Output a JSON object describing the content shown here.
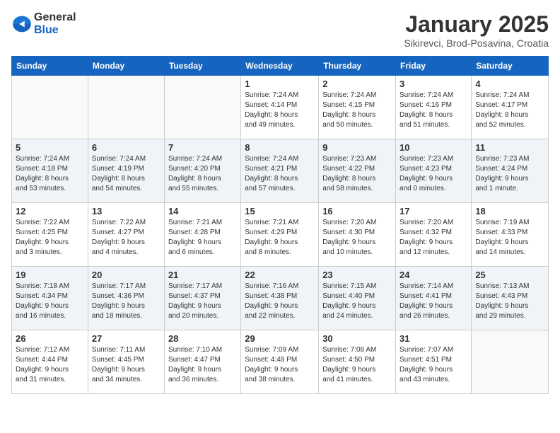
{
  "header": {
    "logo": {
      "general": "General",
      "blue": "Blue"
    },
    "title": "January 2025",
    "subtitle": "Sikirevci, Brod-Posavina, Croatia"
  },
  "days_of_week": [
    "Sunday",
    "Monday",
    "Tuesday",
    "Wednesday",
    "Thursday",
    "Friday",
    "Saturday"
  ],
  "weeks": [
    {
      "shade": false,
      "days": [
        {
          "num": "",
          "info": ""
        },
        {
          "num": "",
          "info": ""
        },
        {
          "num": "",
          "info": ""
        },
        {
          "num": "1",
          "info": "Sunrise: 7:24 AM\nSunset: 4:14 PM\nDaylight: 8 hours\nand 49 minutes."
        },
        {
          "num": "2",
          "info": "Sunrise: 7:24 AM\nSunset: 4:15 PM\nDaylight: 8 hours\nand 50 minutes."
        },
        {
          "num": "3",
          "info": "Sunrise: 7:24 AM\nSunset: 4:16 PM\nDaylight: 8 hours\nand 51 minutes."
        },
        {
          "num": "4",
          "info": "Sunrise: 7:24 AM\nSunset: 4:17 PM\nDaylight: 8 hours\nand 52 minutes."
        }
      ]
    },
    {
      "shade": true,
      "days": [
        {
          "num": "5",
          "info": "Sunrise: 7:24 AM\nSunset: 4:18 PM\nDaylight: 8 hours\nand 53 minutes."
        },
        {
          "num": "6",
          "info": "Sunrise: 7:24 AM\nSunset: 4:19 PM\nDaylight: 8 hours\nand 54 minutes."
        },
        {
          "num": "7",
          "info": "Sunrise: 7:24 AM\nSunset: 4:20 PM\nDaylight: 8 hours\nand 55 minutes."
        },
        {
          "num": "8",
          "info": "Sunrise: 7:24 AM\nSunset: 4:21 PM\nDaylight: 8 hours\nand 57 minutes."
        },
        {
          "num": "9",
          "info": "Sunrise: 7:23 AM\nSunset: 4:22 PM\nDaylight: 8 hours\nand 58 minutes."
        },
        {
          "num": "10",
          "info": "Sunrise: 7:23 AM\nSunset: 4:23 PM\nDaylight: 9 hours\nand 0 minutes."
        },
        {
          "num": "11",
          "info": "Sunrise: 7:23 AM\nSunset: 4:24 PM\nDaylight: 9 hours\nand 1 minute."
        }
      ]
    },
    {
      "shade": false,
      "days": [
        {
          "num": "12",
          "info": "Sunrise: 7:22 AM\nSunset: 4:25 PM\nDaylight: 9 hours\nand 3 minutes."
        },
        {
          "num": "13",
          "info": "Sunrise: 7:22 AM\nSunset: 4:27 PM\nDaylight: 9 hours\nand 4 minutes."
        },
        {
          "num": "14",
          "info": "Sunrise: 7:21 AM\nSunset: 4:28 PM\nDaylight: 9 hours\nand 6 minutes."
        },
        {
          "num": "15",
          "info": "Sunrise: 7:21 AM\nSunset: 4:29 PM\nDaylight: 9 hours\nand 8 minutes."
        },
        {
          "num": "16",
          "info": "Sunrise: 7:20 AM\nSunset: 4:30 PM\nDaylight: 9 hours\nand 10 minutes."
        },
        {
          "num": "17",
          "info": "Sunrise: 7:20 AM\nSunset: 4:32 PM\nDaylight: 9 hours\nand 12 minutes."
        },
        {
          "num": "18",
          "info": "Sunrise: 7:19 AM\nSunset: 4:33 PM\nDaylight: 9 hours\nand 14 minutes."
        }
      ]
    },
    {
      "shade": true,
      "days": [
        {
          "num": "19",
          "info": "Sunrise: 7:18 AM\nSunset: 4:34 PM\nDaylight: 9 hours\nand 16 minutes."
        },
        {
          "num": "20",
          "info": "Sunrise: 7:17 AM\nSunset: 4:36 PM\nDaylight: 9 hours\nand 18 minutes."
        },
        {
          "num": "21",
          "info": "Sunrise: 7:17 AM\nSunset: 4:37 PM\nDaylight: 9 hours\nand 20 minutes."
        },
        {
          "num": "22",
          "info": "Sunrise: 7:16 AM\nSunset: 4:38 PM\nDaylight: 9 hours\nand 22 minutes."
        },
        {
          "num": "23",
          "info": "Sunrise: 7:15 AM\nSunset: 4:40 PM\nDaylight: 9 hours\nand 24 minutes."
        },
        {
          "num": "24",
          "info": "Sunrise: 7:14 AM\nSunset: 4:41 PM\nDaylight: 9 hours\nand 26 minutes."
        },
        {
          "num": "25",
          "info": "Sunrise: 7:13 AM\nSunset: 4:43 PM\nDaylight: 9 hours\nand 29 minutes."
        }
      ]
    },
    {
      "shade": false,
      "days": [
        {
          "num": "26",
          "info": "Sunrise: 7:12 AM\nSunset: 4:44 PM\nDaylight: 9 hours\nand 31 minutes."
        },
        {
          "num": "27",
          "info": "Sunrise: 7:11 AM\nSunset: 4:45 PM\nDaylight: 9 hours\nand 34 minutes."
        },
        {
          "num": "28",
          "info": "Sunrise: 7:10 AM\nSunset: 4:47 PM\nDaylight: 9 hours\nand 36 minutes."
        },
        {
          "num": "29",
          "info": "Sunrise: 7:09 AM\nSunset: 4:48 PM\nDaylight: 9 hours\nand 38 minutes."
        },
        {
          "num": "30",
          "info": "Sunrise: 7:08 AM\nSunset: 4:50 PM\nDaylight: 9 hours\nand 41 minutes."
        },
        {
          "num": "31",
          "info": "Sunrise: 7:07 AM\nSunset: 4:51 PM\nDaylight: 9 hours\nand 43 minutes."
        },
        {
          "num": "",
          "info": ""
        }
      ]
    }
  ]
}
